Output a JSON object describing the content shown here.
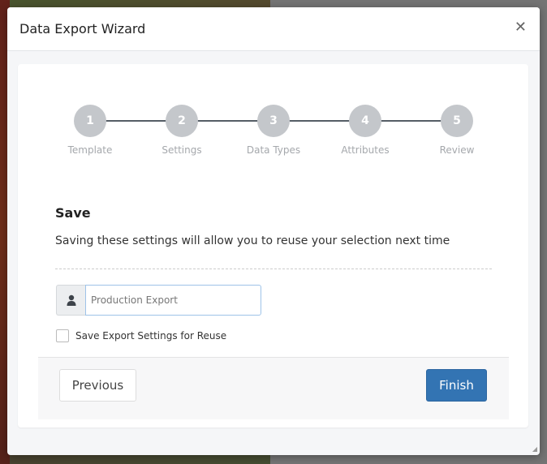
{
  "dialog": {
    "title": "Data Export Wizard",
    "close_icon": "close-icon"
  },
  "steps": [
    {
      "number": "1",
      "label": "Template"
    },
    {
      "number": "2",
      "label": "Settings"
    },
    {
      "number": "3",
      "label": "Data Types"
    },
    {
      "number": "4",
      "label": "Attributes"
    },
    {
      "number": "5",
      "label": "Review"
    }
  ],
  "save": {
    "heading": "Save",
    "description": "Saving these settings will allow you to reuse your selection next time",
    "name_placeholder": "Production Export",
    "name_value": "",
    "checkbox_label": "Save Export Settings for Reuse",
    "checkbox_checked": false
  },
  "footer": {
    "previous_label": "Previous",
    "finish_label": "Finish"
  },
  "colors": {
    "primary": "#3374b3",
    "step_inactive": "#c4c7cb"
  }
}
